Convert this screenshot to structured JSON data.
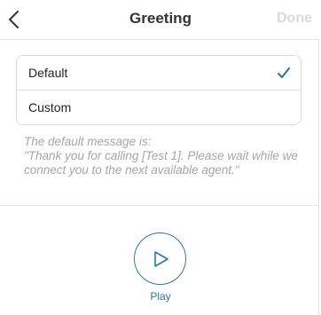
{
  "header": {
    "title": "Greeting",
    "done_label": "Done",
    "back_icon": "chevron-left-icon"
  },
  "options": [
    {
      "label": "Default",
      "selected": true
    },
    {
      "label": "Custom",
      "selected": false
    }
  ],
  "description": {
    "line1": "The default message is:",
    "line2": "\"Thank you for calling [Test 1]. Please wait while we",
    "line3": "connect you to the next available agent.\""
  },
  "play": {
    "label": "Play",
    "icon": "play-icon"
  },
  "colors": {
    "accent": "#2a7aa6",
    "checkmark": "#2a6f9e",
    "disabled": "#d9d9d9",
    "hint_text": "#a6a6a6"
  }
}
